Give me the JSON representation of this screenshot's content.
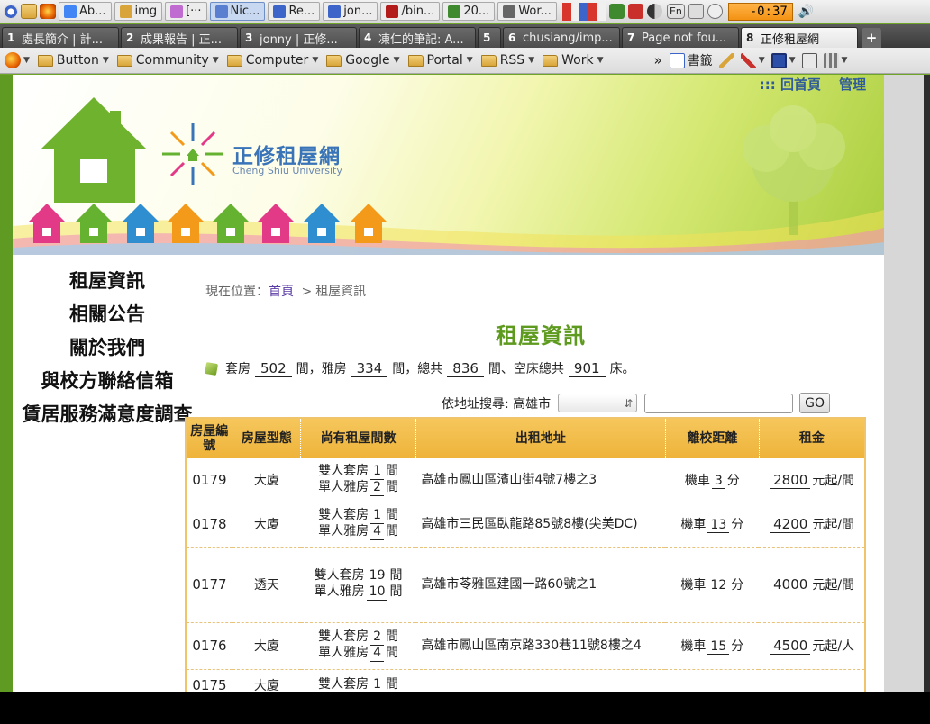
{
  "taskbar": {
    "windows": [
      {
        "label": "Ab...",
        "icon": "chrome-icon"
      },
      {
        "label": "img",
        "icon": "folder-icon"
      },
      {
        "label": "[···",
        "icon": "user-icon"
      },
      {
        "label": "Nic...",
        "icon": "network-icon",
        "active": true
      },
      {
        "label": "Re...",
        "icon": "app-icon"
      },
      {
        "label": "jon...",
        "icon": "app-icon"
      },
      {
        "label": "/bin...",
        "icon": "terminal-icon"
      },
      {
        "label": "20...",
        "icon": "app-icon"
      },
      {
        "label": "Wor...",
        "icon": "app-icon"
      }
    ],
    "language": "En",
    "clock": "-0:37",
    "flag_colors": [
      "#d8362c",
      "#f0f0f0",
      "#3d64c8",
      "#d8362c",
      "#f0f0f0"
    ]
  },
  "tabs": [
    {
      "num": "1",
      "title": "處長簡介 | 計..."
    },
    {
      "num": "2",
      "title": "成果報告 | 正..."
    },
    {
      "num": "3",
      "title": "jonny | 正修..."
    },
    {
      "num": "4",
      "title": "凍仁的筆記: A..."
    },
    {
      "num": "5",
      "title": ""
    },
    {
      "num": "6",
      "title": "chusiang/imp..."
    },
    {
      "num": "7",
      "title": "Page not fou..."
    },
    {
      "num": "8",
      "title": "正修租屋網",
      "active": true
    }
  ],
  "newtab": "+",
  "bookmarks": {
    "folders": [
      "Button",
      "Community",
      "Computer",
      "Google",
      "Portal",
      "RSS",
      "Work"
    ],
    "overflow": "»",
    "bookmarks_label": "書籤"
  },
  "site": {
    "toplinks": [
      "::: 回首頁",
      "管理"
    ],
    "logo_cn": "正修租屋網",
    "logo_en": "Cheng Shiu University"
  },
  "nav": [
    "租屋資訊",
    "相關公告",
    "關於我們",
    "與校方聯絡信箱",
    "賃居服務滿意度調查"
  ],
  "breadcrumb": {
    "prefix": "現在位置：",
    "home": "首頁",
    "sep": ">",
    "current": "租屋資訊"
  },
  "title": "租屋資訊",
  "summary": {
    "t1": "套房",
    "suite_count": "502",
    "t2": "間，雅房",
    "room_count": "334",
    "t3": "間，總共",
    "total_count": "836",
    "t4": "間、空床總共",
    "bed_count": "901",
    "t5": "床。"
  },
  "search": {
    "label": "依地址搜尋: 高雄市",
    "select_value": "",
    "input_value": "",
    "button": "GO"
  },
  "table": {
    "headers": [
      "房屋編號",
      "房屋型態",
      "尚有租屋間數",
      "出租地址",
      "離校距離",
      "租金"
    ],
    "rows": [
      {
        "id": "0179",
        "type": "大廈",
        "suite_label": "雙人套房",
        "suite": "1",
        "room_label": "單人雅房",
        "room": "2",
        "unit": "間",
        "address": "高雄市鳳山區濱山街4號7樓之3",
        "visited": false,
        "distance_label": "機車",
        "distance": "3",
        "distance_unit": "分",
        "rent": "2800",
        "rent_unit": "元起/間"
      },
      {
        "id": "0178",
        "type": "大廈",
        "suite_label": "雙人套房",
        "suite": "1",
        "room_label": "單人雅房",
        "room": "4",
        "unit": "間",
        "address": "高雄市三民區臥龍路85號8樓(尖美DC)",
        "visited": true,
        "distance_label": "機車",
        "distance": "13",
        "distance_unit": "分",
        "rent": "4200",
        "rent_unit": "元起/間"
      },
      {
        "id": "0177",
        "type": "透天",
        "suite_label": "雙人套房",
        "suite": "19",
        "room_label": "單人雅房",
        "room": "10",
        "unit": "間",
        "address": "高雄市苓雅區建國一路60號之1",
        "visited": false,
        "distance_label": "機車",
        "distance": "12",
        "distance_unit": "分",
        "rent": "4000",
        "rent_unit": "元起/間"
      },
      {
        "id": "0176",
        "type": "大廈",
        "suite_label": "雙人套房",
        "suite": "2",
        "room_label": "單人雅房",
        "room": "4",
        "unit": "間",
        "address": "高雄市鳳山區南京路330巷11號8樓之4",
        "visited": false,
        "distance_label": "機車",
        "distance": "15",
        "distance_unit": "分",
        "rent": "4500",
        "rent_unit": "元起/人"
      },
      {
        "id": "0175",
        "type": "大廈",
        "suite_label": "雙人套房",
        "suite": "1",
        "room_label": "",
        "room": "",
        "unit": "間",
        "address": "",
        "visited": false,
        "distance_label": "",
        "distance": "",
        "distance_unit": "",
        "rent": "",
        "rent_unit": ""
      }
    ]
  }
}
